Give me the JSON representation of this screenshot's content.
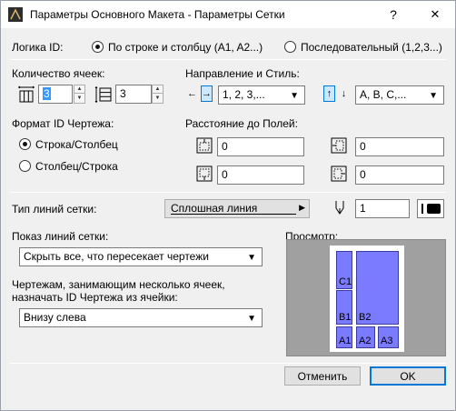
{
  "window": {
    "title": "Параметры Основного Макета - Параметры Сетки",
    "help_label": "?",
    "close_label": "✕"
  },
  "logic": {
    "label": "Логика ID:",
    "option_row_col": "По строке и столбцу (A1, A2...)",
    "option_sequential": "Последовательный (1,2,3...)",
    "selected": "option_row_col"
  },
  "cells": {
    "label": "Количество ячеек:",
    "horizontal_value": "3",
    "vertical_value": "3"
  },
  "direction": {
    "label": "Направление и Стиль:",
    "h_left_arrow": "←",
    "h_right_arrow": "→",
    "h_style": "1, 2, 3,...",
    "v_up_arrow": "↑",
    "v_down_arrow": "↓",
    "v_style": "A, B, C,..."
  },
  "id_format": {
    "label": "Формат ID Чертежа:",
    "option_row_col": "Строка/Столбец",
    "option_col_row": "Столбец/Строка",
    "selected": "option_row_col"
  },
  "margins": {
    "label": "Расстояние до Полей:",
    "top": "0",
    "left": "0",
    "bottom": "0",
    "right": "0"
  },
  "line_type": {
    "label": "Тип линий сетки:",
    "value": "Сплошная линия",
    "pen_value": "1"
  },
  "show_lines": {
    "label": "Показ линий сетки:",
    "value": "Скрыть все, что пересекает чертежи"
  },
  "multi_cell": {
    "label_line1": "Чертежам, занимающим несколько ячеек,",
    "label_line2": "назначать ID Чертежа из ячейки:",
    "value": "Внизу слева"
  },
  "preview": {
    "label": "Просмотр:",
    "cells": [
      "C1",
      "B1",
      "B2",
      "A1",
      "A2",
      "A3"
    ],
    "cell_color": "#7b7bff",
    "background_color": "#a0a0a0"
  },
  "footer": {
    "cancel_label": "Отменить",
    "ok_label": "OK"
  }
}
